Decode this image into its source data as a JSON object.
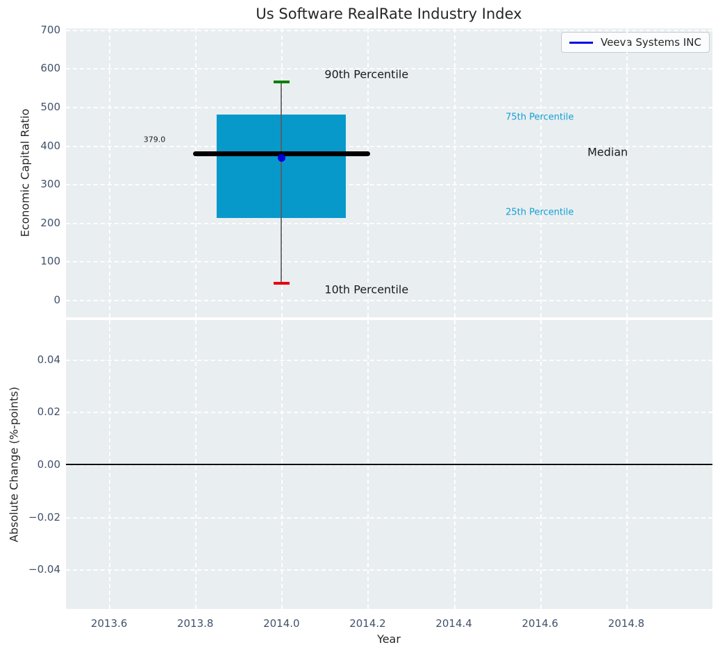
{
  "figure": {
    "title": "Us Software RealRate Industry Index",
    "legend": {
      "label": "Veeva Systems INC",
      "line_color": "#0000e0",
      "position": "upper right"
    }
  },
  "chart_data": [
    {
      "type": "box",
      "title": "Us Software RealRate Industry Index",
      "xlabel": "Year",
      "ylabel": "Economic Capital Ratio",
      "xlim": [
        2013.5,
        2015.0
      ],
      "ylim": [
        -45,
        703
      ],
      "grid": true,
      "legend": {
        "label": "Veeva Systems INC",
        "position": "upper right"
      },
      "xticks": {
        "values": [
          2013.6,
          2013.8,
          2014.0,
          2014.2,
          2014.4,
          2014.6,
          2014.8
        ],
        "labels": [
          "2013.6",
          "2013.8",
          "2014.0",
          "2014.2",
          "2014.4",
          "2014.6",
          "2014.8"
        ],
        "show_labels": false
      },
      "yticks": {
        "values": [
          0,
          100,
          200,
          300,
          400,
          500,
          600,
          700
        ],
        "labels": [
          "0",
          "100",
          "200",
          "300",
          "400",
          "500",
          "600",
          "700"
        ]
      },
      "box": {
        "x": 2014,
        "p10": 44,
        "p25": 213,
        "median": 379,
        "p75": 480,
        "p90": 565,
        "median_label": "379.0",
        "company_point": {
          "name": "Veeva Systems INC",
          "x": 2014,
          "y": 368
        }
      },
      "annotations": [
        {
          "text": "90th Percentile",
          "x": 2014.1,
          "y": 585,
          "color": "#1a1a1a",
          "font_px": 16
        },
        {
          "text": "10th Percentile",
          "x": 2014.1,
          "y": 27,
          "color": "#1a1a1a",
          "font_px": 16
        },
        {
          "text": "75th Percentile",
          "x": 2014.52,
          "y": 473,
          "color": "#149fd3",
          "font_px": 13
        },
        {
          "text": "25th Percentile",
          "x": 2014.52,
          "y": 227,
          "color": "#149fd3",
          "font_px": 13
        },
        {
          "text": "Median",
          "x": 2014.71,
          "y": 383,
          "color": "#1a1a1a",
          "font_px": 16
        },
        {
          "text": "379.0",
          "x": 2013.68,
          "y": 415,
          "color": "#1a1a1a",
          "font_px": 11
        }
      ],
      "colors": {
        "box_fill": "#0899cb",
        "median_line": "#000000",
        "whisker": "#5a5a5a",
        "cap_top": "#008000",
        "cap_bottom": "#e8000b",
        "company_marker": "#0000e0",
        "axes_background": "#e9eef1",
        "grid_line": "#ffffff",
        "tick_label": "#42506b"
      }
    },
    {
      "type": "line",
      "xlabel": "Year",
      "ylabel": "Absolute Change (%-points)",
      "xlim": [
        2013.5,
        2015.0
      ],
      "ylim": [
        -0.055,
        0.055
      ],
      "grid": true,
      "xticks": {
        "values": [
          2013.6,
          2013.8,
          2014.0,
          2014.2,
          2014.4,
          2014.6,
          2014.8
        ],
        "labels": [
          "2013.6",
          "2013.8",
          "2014.0",
          "2014.2",
          "2014.4",
          "2014.6",
          "2014.8"
        ],
        "show_labels": true
      },
      "yticks": {
        "values": [
          0.04,
          0.02,
          0.0,
          -0.02,
          -0.04
        ],
        "labels": [
          "0.04",
          "0.02",
          "0.00",
          "−0.02",
          "−0.04"
        ]
      },
      "zero_line": {
        "y": 0.0,
        "color": "#000000"
      },
      "series": []
    }
  ]
}
